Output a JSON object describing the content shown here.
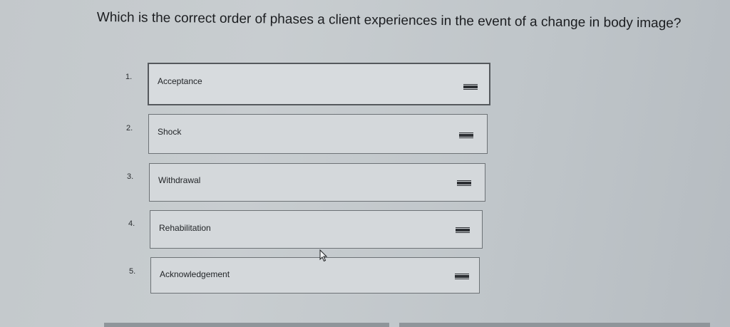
{
  "question": {
    "text": "Which is the correct order of phases a client experiences in the event of a change in body image?"
  },
  "items": [
    {
      "number": "1.",
      "label": "Acceptance"
    },
    {
      "number": "2.",
      "label": "Shock"
    },
    {
      "number": "3.",
      "label": "Withdrawal"
    },
    {
      "number": "4.",
      "label": "Rehabilitation"
    },
    {
      "number": "5.",
      "label": "Acknowledgement"
    }
  ],
  "icons": {
    "drag_handle": "drag-handle-icon",
    "cursor": "mouse-pointer-icon"
  },
  "colors": {
    "background": "#c4c9cc",
    "box_fill": "#d4d8db",
    "box_border": "#6d7276",
    "text": "#1e2124"
  }
}
